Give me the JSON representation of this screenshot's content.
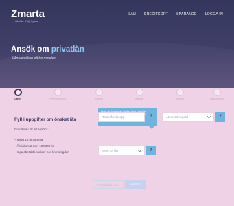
{
  "brand": {
    "name": "Zmarta",
    "tagline": "Jämför. Välj. Spara."
  },
  "nav": {
    "items": [
      "LÅN",
      "KREDITKORT",
      "SPARANDE",
      "LOGGA IN"
    ]
  },
  "hero": {
    "title_prefix": "Ansök om",
    "title_accent": "privatlån",
    "subtitle": "Låneansökan på tre minuter!"
  },
  "steps": {
    "current": 1,
    "items": [
      {
        "label": "Lånet"
      },
      {
        "label": "Personuppgifter"
      },
      {
        "label": "Boende"
      },
      {
        "label": "Inkomst"
      },
      {
        "label": "Skulder"
      },
      {
        "label": "Medsökande"
      }
    ]
  },
  "form": {
    "title": "Fyll i uppgifter om önskat lån",
    "intro": "Grundkrav för att ansöka:",
    "requirements": [
      "– Minst 18 år gammal",
      "– Årsinkomst över 100.000 kr",
      "– Inga obetalda skulder hos kronofogden"
    ],
    "tooltip": "Ange det belopp du önskar låna exklusive befintliga lån du vill lösa. Du kan låna mellan 1 000–400 000 kr",
    "help_label": "?",
    "fields": {
      "amount_placeholder": "Totalt lånebelopp",
      "term_placeholder": "Återbetalningstid",
      "purpose_placeholder": "Syfte för lån"
    }
  },
  "buttons": {
    "prev_label": "FÖREGÅENDE",
    "next_label": "NÄSTA"
  },
  "colors": {
    "hero": "#3f3f68",
    "accent": "#8ec6ee",
    "help": "#6fb4df",
    "background": "#f0d2e6"
  }
}
